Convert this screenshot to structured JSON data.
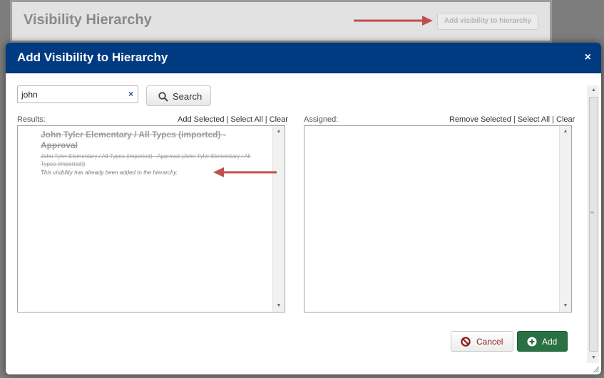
{
  "background": {
    "title": "Visibility Hierarchy",
    "add_button_label": "Add visibility to hierarchy"
  },
  "modal": {
    "title": "Add Visibility to Hierarchy",
    "close_glyph": "×"
  },
  "search": {
    "value": "john",
    "clear_glyph": "×",
    "button_label": "Search"
  },
  "results": {
    "label": "Results:",
    "links": [
      "Add Selected",
      "Select All",
      "Clear"
    ],
    "items": [
      {
        "title": "John Tyler Elementary / All Types (imported) - Approval",
        "description": "John Tyler Elementary / All Types (imported) - Approval (John Tyler Elementary / All Types (imported))",
        "note": "This visibility has already been added to the hierarchy."
      }
    ]
  },
  "assigned": {
    "label": "Assigned:",
    "links": [
      "Remove Selected",
      "Select All",
      "Clear"
    ]
  },
  "footer": {
    "cancel_label": "Cancel",
    "add_label": "Add"
  },
  "icons": {
    "search": "magnifier-icon",
    "cancel": "ban-icon",
    "add": "plus-circle-icon",
    "annotation": "red-arrow-icon"
  },
  "colors": {
    "header": "#003a80",
    "add_button": "#2a7043",
    "cancel_text": "#8a1c1c",
    "annotation_arrow": "#c0504d"
  }
}
